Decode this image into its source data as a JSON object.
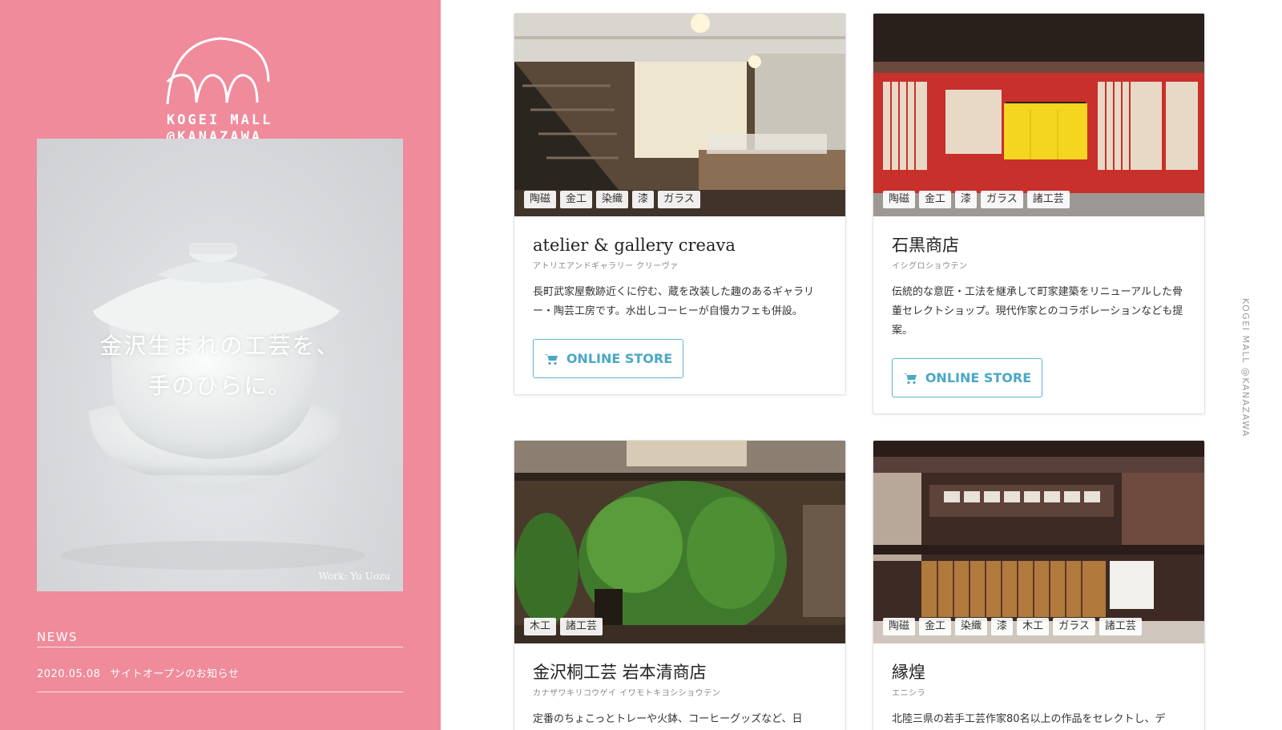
{
  "sidebar": {
    "logo_line1": "KOGEI MALL",
    "logo_line2": "@KANAZAWA",
    "hero_copy_line1": "金沢生まれの工芸を、",
    "hero_copy_line2": "手のひらに。",
    "hero_credit": "Work: Yu Uozu",
    "news_heading": "NEWS",
    "news": [
      {
        "date": "2020.05.08",
        "title": "サイトオープンのお知らせ"
      }
    ]
  },
  "shops": [
    {
      "name": "atelier & gallery creava",
      "kana": "アトリエアンドギャラリー クリーヴァ",
      "tags": [
        "陶磁",
        "金工",
        "染織",
        "漆",
        "ガラス"
      ],
      "description": "長町武家屋敷跡近くに佇む、蔵を改装した趣のあるギャラリー・陶芸工房です。水出しコーヒーが自慢カフェも併設。",
      "button": "ONLINE STORE"
    },
    {
      "name": "石黒商店",
      "kana": "イシグロショウテン",
      "tags": [
        "陶磁",
        "金工",
        "漆",
        "ガラス",
        "諸工芸"
      ],
      "description": "伝統的な意匠・工法を継承して町家建築をリニューアルした骨董セレクトショップ。現代作家とのコラボレーションなども提案。",
      "button": "ONLINE STORE"
    },
    {
      "name": "金沢桐工芸 岩本清商店",
      "kana": "カナザワキリコウゲイ イワモトキヨシショウテン",
      "tags": [
        "木工",
        "諸工芸"
      ],
      "description": "定番のちょこっとトレーや火鉢、コーヒーグッズなど、日"
    },
    {
      "name": "縁煌",
      "kana": "エニシラ",
      "tags": [
        "陶磁",
        "金工",
        "染織",
        "漆",
        "木工",
        "ガラス",
        "諸工芸"
      ],
      "description": "北陸三県の若手工芸作家80名以上の作品をセレクトし、デ"
    }
  ],
  "vertical_brand": "KOGEI MALL @KANAZAWA",
  "colors": {
    "sidebar_bg": "#ef8b9b",
    "button_accent": "#4aa8c6"
  }
}
